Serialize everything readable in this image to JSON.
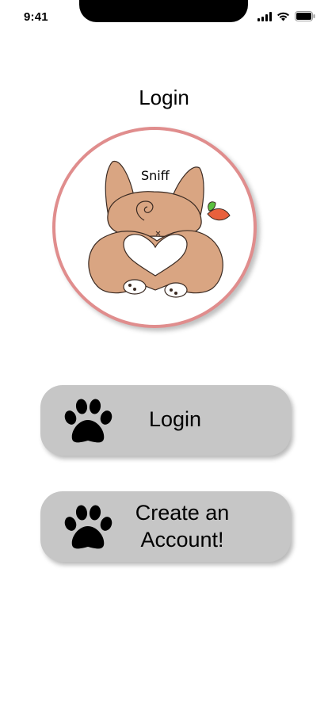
{
  "status_bar": {
    "time": "9:41",
    "icons": [
      "cellular-signal-icon",
      "wifi-icon",
      "battery-icon"
    ]
  },
  "page": {
    "title": "Login"
  },
  "logo": {
    "caption": "Sniff",
    "border_color": "#e08d8d"
  },
  "buttons": {
    "login": {
      "label": "Login",
      "icon": "paw-icon"
    },
    "create_account": {
      "label_line1": "Create an",
      "label_line2": "Account!",
      "icon": "paw-icon"
    }
  },
  "colors": {
    "button_bg": "#c6c6c6",
    "paw": "#000000"
  }
}
